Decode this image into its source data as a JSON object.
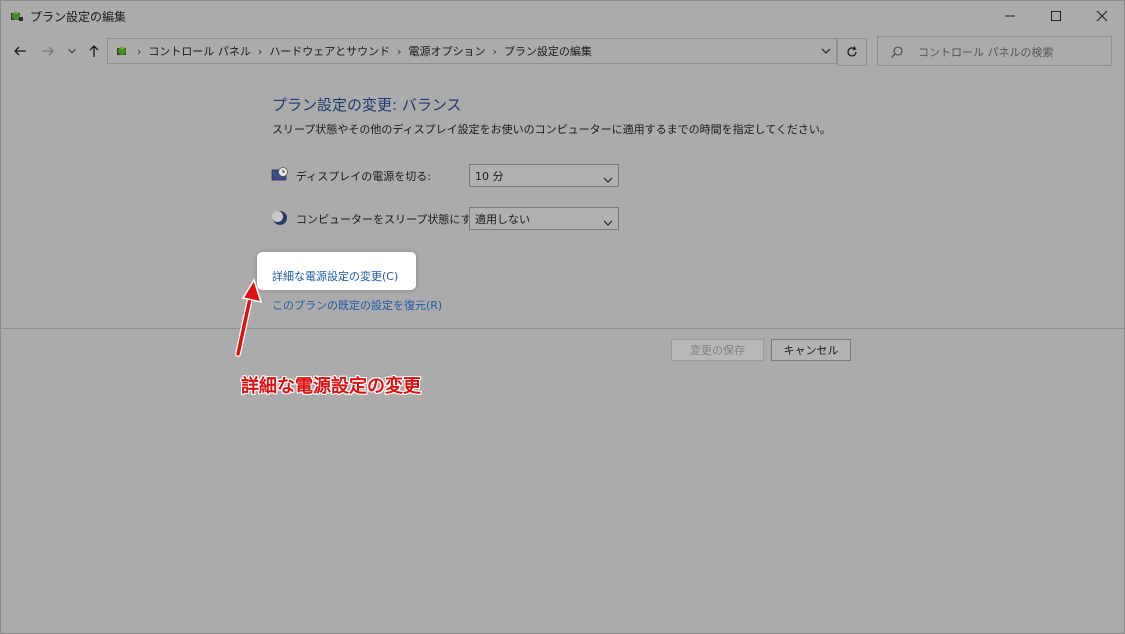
{
  "window": {
    "title": "プラン設定の編集"
  },
  "address_bar": {
    "crumbs": [
      "コントロール パネル",
      "ハードウェアとサウンド",
      "電源オプション",
      "プラン設定の編集"
    ],
    "separator": "›"
  },
  "search": {
    "placeholder": "コントロール パネルの検索"
  },
  "content": {
    "heading": "プラン設定の変更: バランス",
    "description": "スリープ状態やその他のディスプレイ設定をお使いのコンピューターに適用するまでの時間を指定してください。",
    "display_off": {
      "label": "ディスプレイの電源を切る:",
      "value": "10 分"
    },
    "sleep": {
      "label": "コンピューターをスリープ状態にする:",
      "value": "適用しない"
    },
    "advanced_link": "詳細な電源設定の変更(C)",
    "restore_link": "このプランの既定の設定を復元(R)"
  },
  "buttons": {
    "save": "変更の保存",
    "cancel": "キャンセル"
  },
  "annotation": {
    "text": "詳細な電源設定の変更",
    "color": "#e01010"
  },
  "icons": {
    "app": "power-options-icon",
    "back": "back-arrow-icon",
    "forward": "forward-arrow-icon",
    "recent": "chevron-down-icon",
    "up": "up-arrow-icon",
    "refresh": "refresh-icon",
    "search": "search-icon",
    "display": "display-timer-icon",
    "sleep": "sleep-moon-icon"
  }
}
